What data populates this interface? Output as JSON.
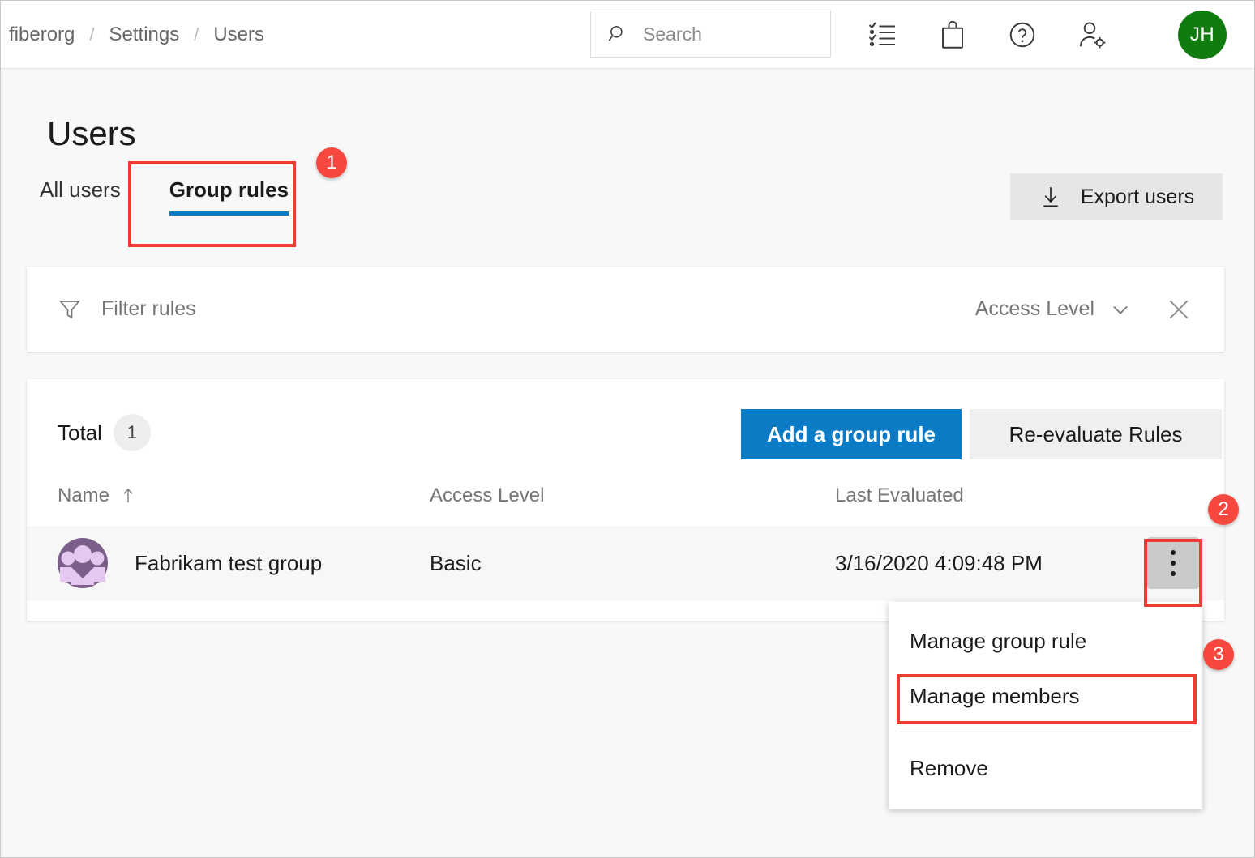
{
  "header": {
    "breadcrumb": [
      {
        "label": "fiberorg",
        "icon": ""
      },
      {
        "label": "/",
        "icon": "separator"
      },
      {
        "label": "Settings",
        "icon": ""
      },
      {
        "label": "/",
        "icon": "separator"
      },
      {
        "label": "Users",
        "icon": ""
      }
    ],
    "search": {
      "placeholder": "Search",
      "value": "",
      "icon": "search-icon"
    },
    "icons": [
      {
        "name": "tasks-checklist-icon"
      },
      {
        "name": "marketplace-bag-icon"
      },
      {
        "name": "help-question-icon"
      },
      {
        "name": "user-settings-icon"
      }
    ],
    "avatar": {
      "initials": "JH",
      "color": "#107c10"
    }
  },
  "page": {
    "title": "Users",
    "tabs": [
      {
        "label": "All users",
        "active": false
      },
      {
        "label": "Group rules",
        "active": true
      }
    ],
    "export_button": {
      "label": "Export users",
      "icon": "download-arrow-icon"
    }
  },
  "filter": {
    "icon": "funnel-filter-icon",
    "label": "Filter rules",
    "access_level_label": "Access Level",
    "chevron_icon": "chevron-down-icon",
    "clear_icon": "close-x-icon"
  },
  "table": {
    "total_label": "Total",
    "total_count": "1",
    "add_rule_button": "Add a group rule",
    "reevaluate_button": "Re-evaluate Rules",
    "columns": [
      {
        "label": "Name",
        "sort_icon": "sort-arrow-up-icon"
      },
      {
        "label": "Access Level",
        "sort_icon": ""
      },
      {
        "label": "Last Evaluated",
        "sort_icon": ""
      }
    ],
    "rows": [
      {
        "avatar_icon": "group-avatar-icon",
        "name": "Fabrikam test group",
        "access_level": "Basic",
        "last_evaluated": "3/16/2020 4:09:48 PM",
        "menu_icon": "kebab-more-icon"
      }
    ]
  },
  "context_menu": {
    "items": [
      {
        "label": "Manage group rule",
        "highlighted": false
      },
      {
        "label": "Manage members",
        "highlighted": true
      },
      {
        "label": "Remove",
        "highlighted": false
      }
    ]
  },
  "annotations": {
    "badges": [
      {
        "number": "1",
        "target": "group-rules-tab"
      },
      {
        "number": "2",
        "target": "row-kebab-menu-button"
      },
      {
        "number": "3",
        "target": "manage-members-menu-item"
      }
    ],
    "color": "#f7473f"
  },
  "colors": {
    "accent_blue": "#0a7bc4",
    "avatar_green": "#107c10",
    "annotation_red": "#f7473f",
    "group_avatar_purple": "#7a5f8a"
  }
}
